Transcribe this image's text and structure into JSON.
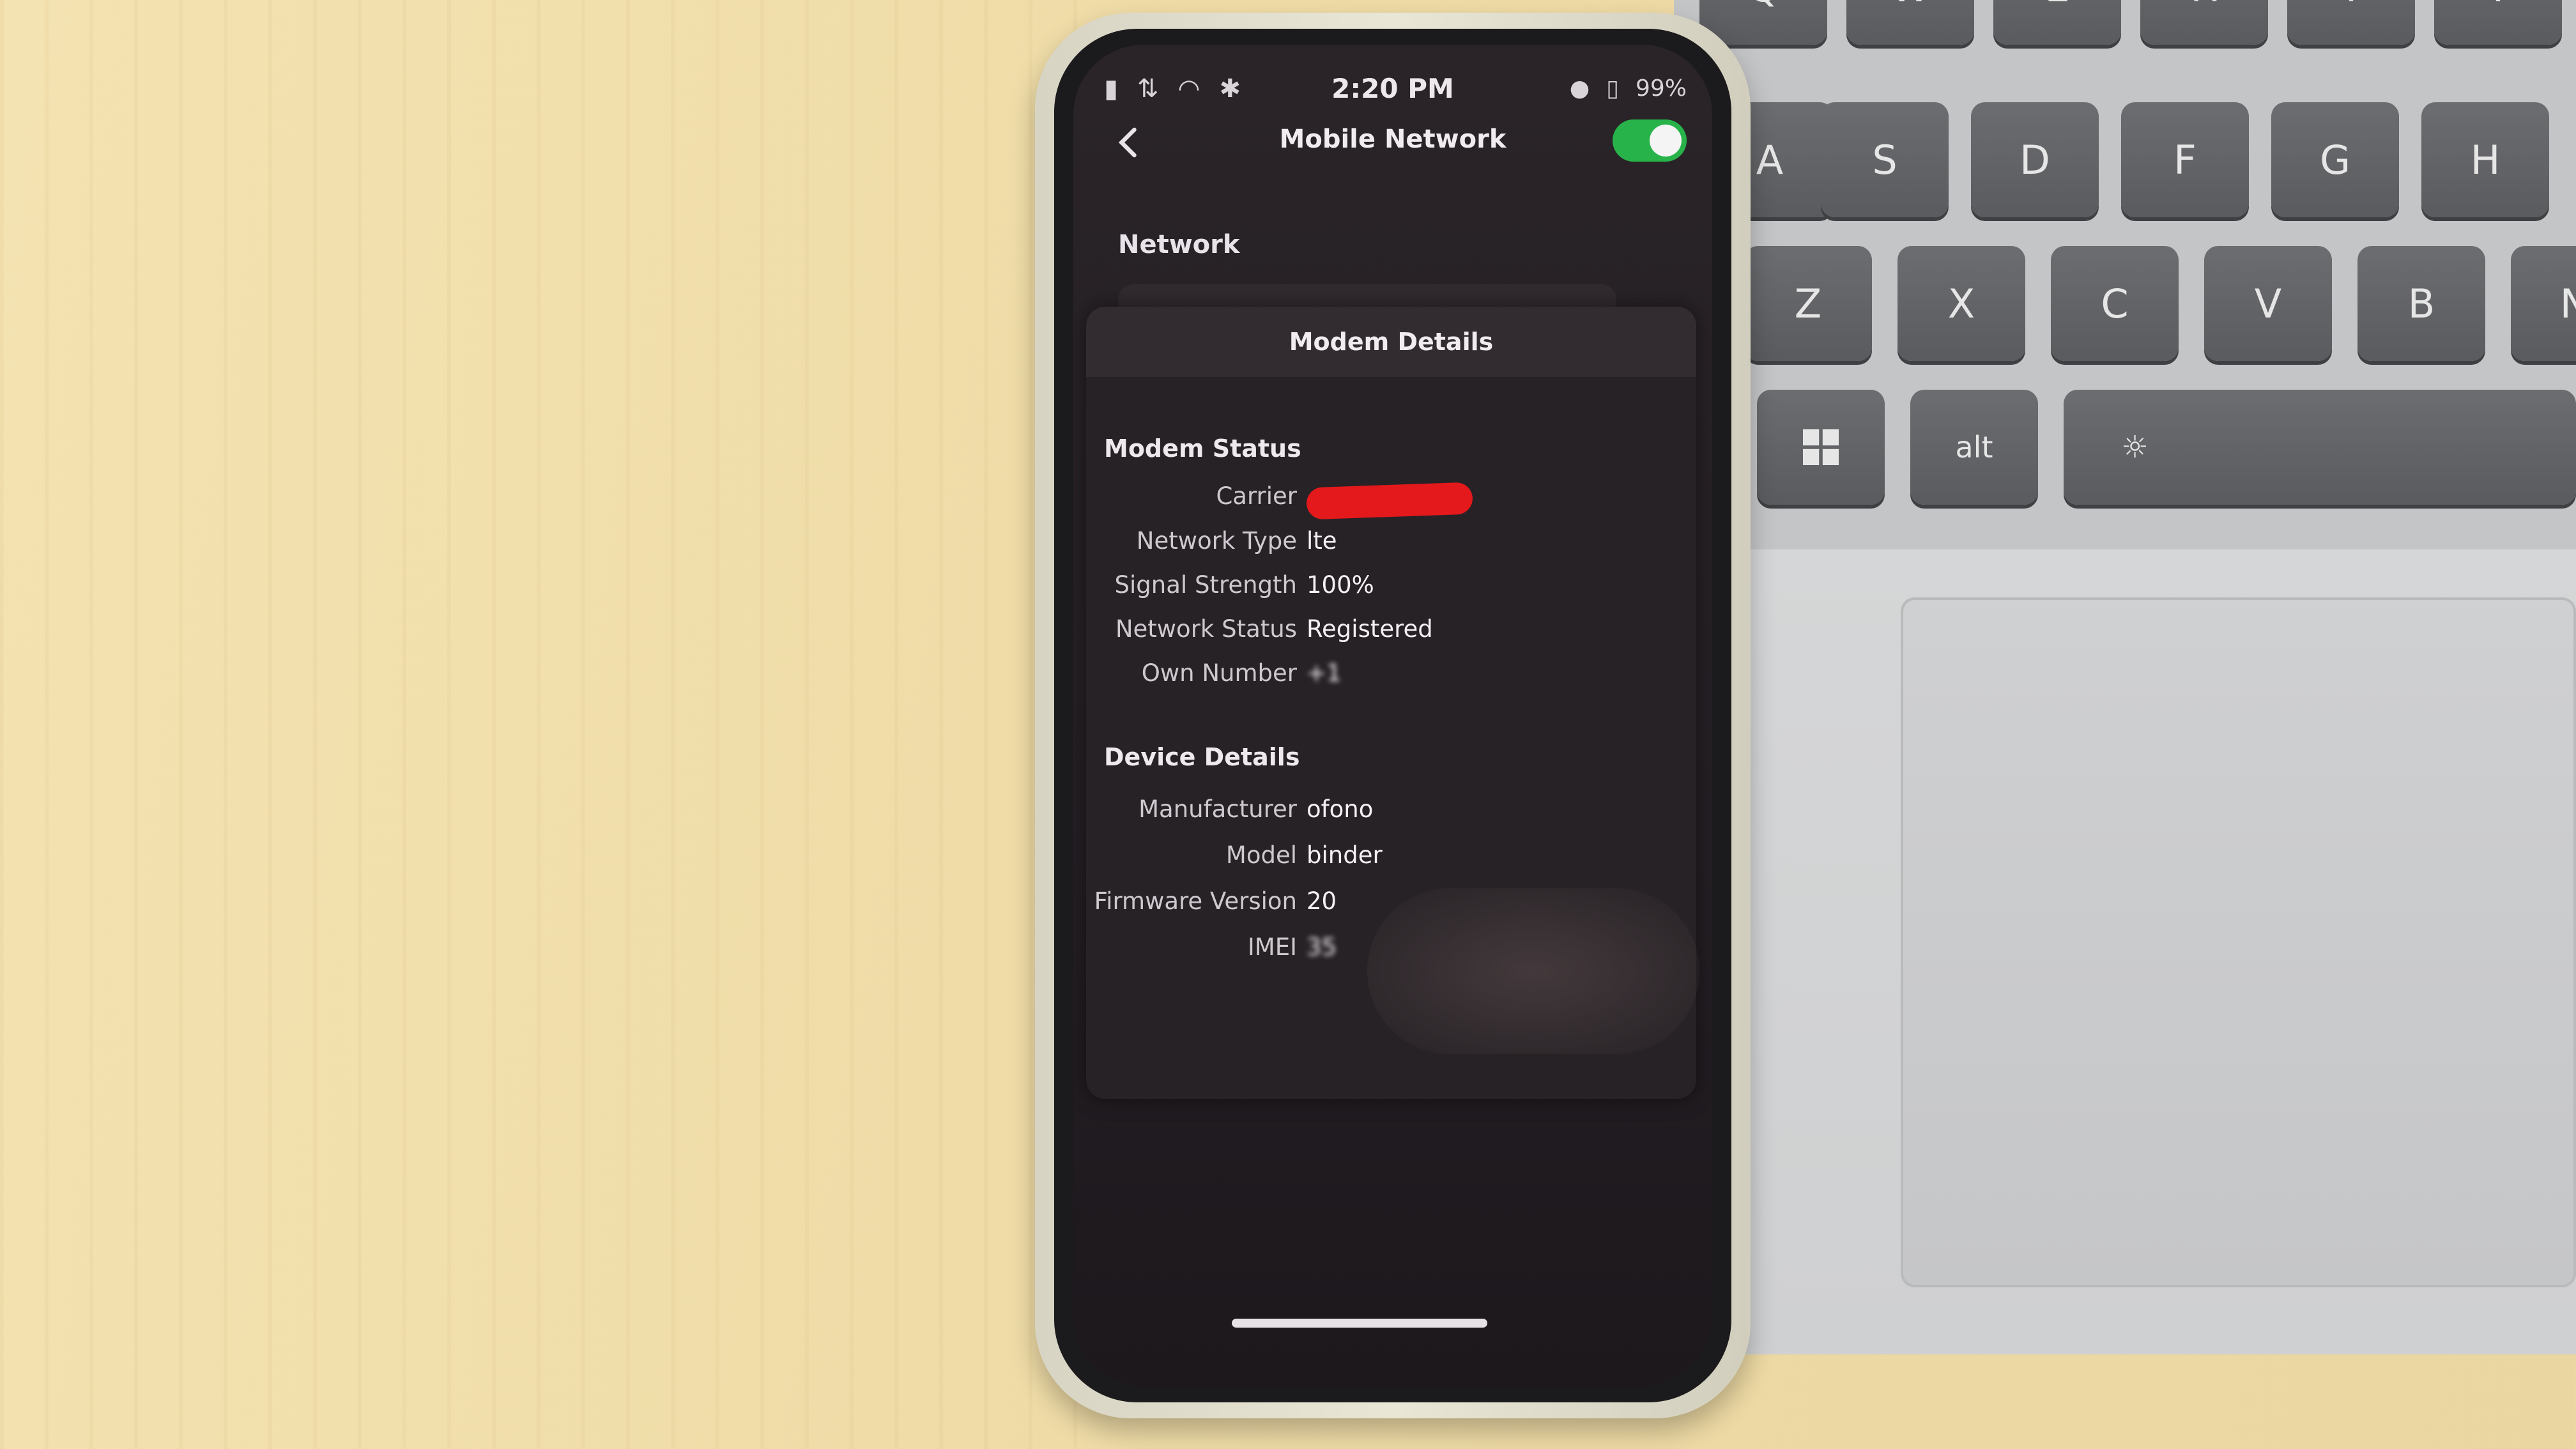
{
  "keyboard": {
    "row1": [
      "Q",
      "W",
      "E",
      "R",
      "T",
      "Y"
    ],
    "row2": [
      "A",
      "S",
      "D",
      "F",
      "G",
      "H"
    ],
    "row3": [
      "Z",
      "X",
      "C",
      "V",
      "B",
      "N"
    ],
    "row4_alt": "alt"
  },
  "phone": {
    "status_bar": {
      "time": "2:20 PM",
      "battery": "99%"
    },
    "app_bar": {
      "title": "Mobile Network",
      "toggle_on": true
    },
    "section": "Network",
    "dialog": {
      "title": "Modem Details",
      "modem_status": {
        "heading": "Modem Status",
        "rows": [
          {
            "label": "Carrier",
            "value": ""
          },
          {
            "label": "Network Type",
            "value": "lte"
          },
          {
            "label": "Signal Strength",
            "value": "100%"
          },
          {
            "label": "Network Status",
            "value": "Registered"
          },
          {
            "label": "Own Number",
            "value": "+1"
          }
        ]
      },
      "device_details": {
        "heading": "Device Details",
        "rows": [
          {
            "label": "Manufacturer",
            "value": "ofono"
          },
          {
            "label": "Model",
            "value": "binder"
          },
          {
            "label": "Firmware Version",
            "value": "20"
          },
          {
            "label": "IMEI",
            "value": "35"
          }
        ]
      }
    }
  },
  "colors": {
    "toggle": "#27b34a",
    "redaction": "#e3191c"
  }
}
